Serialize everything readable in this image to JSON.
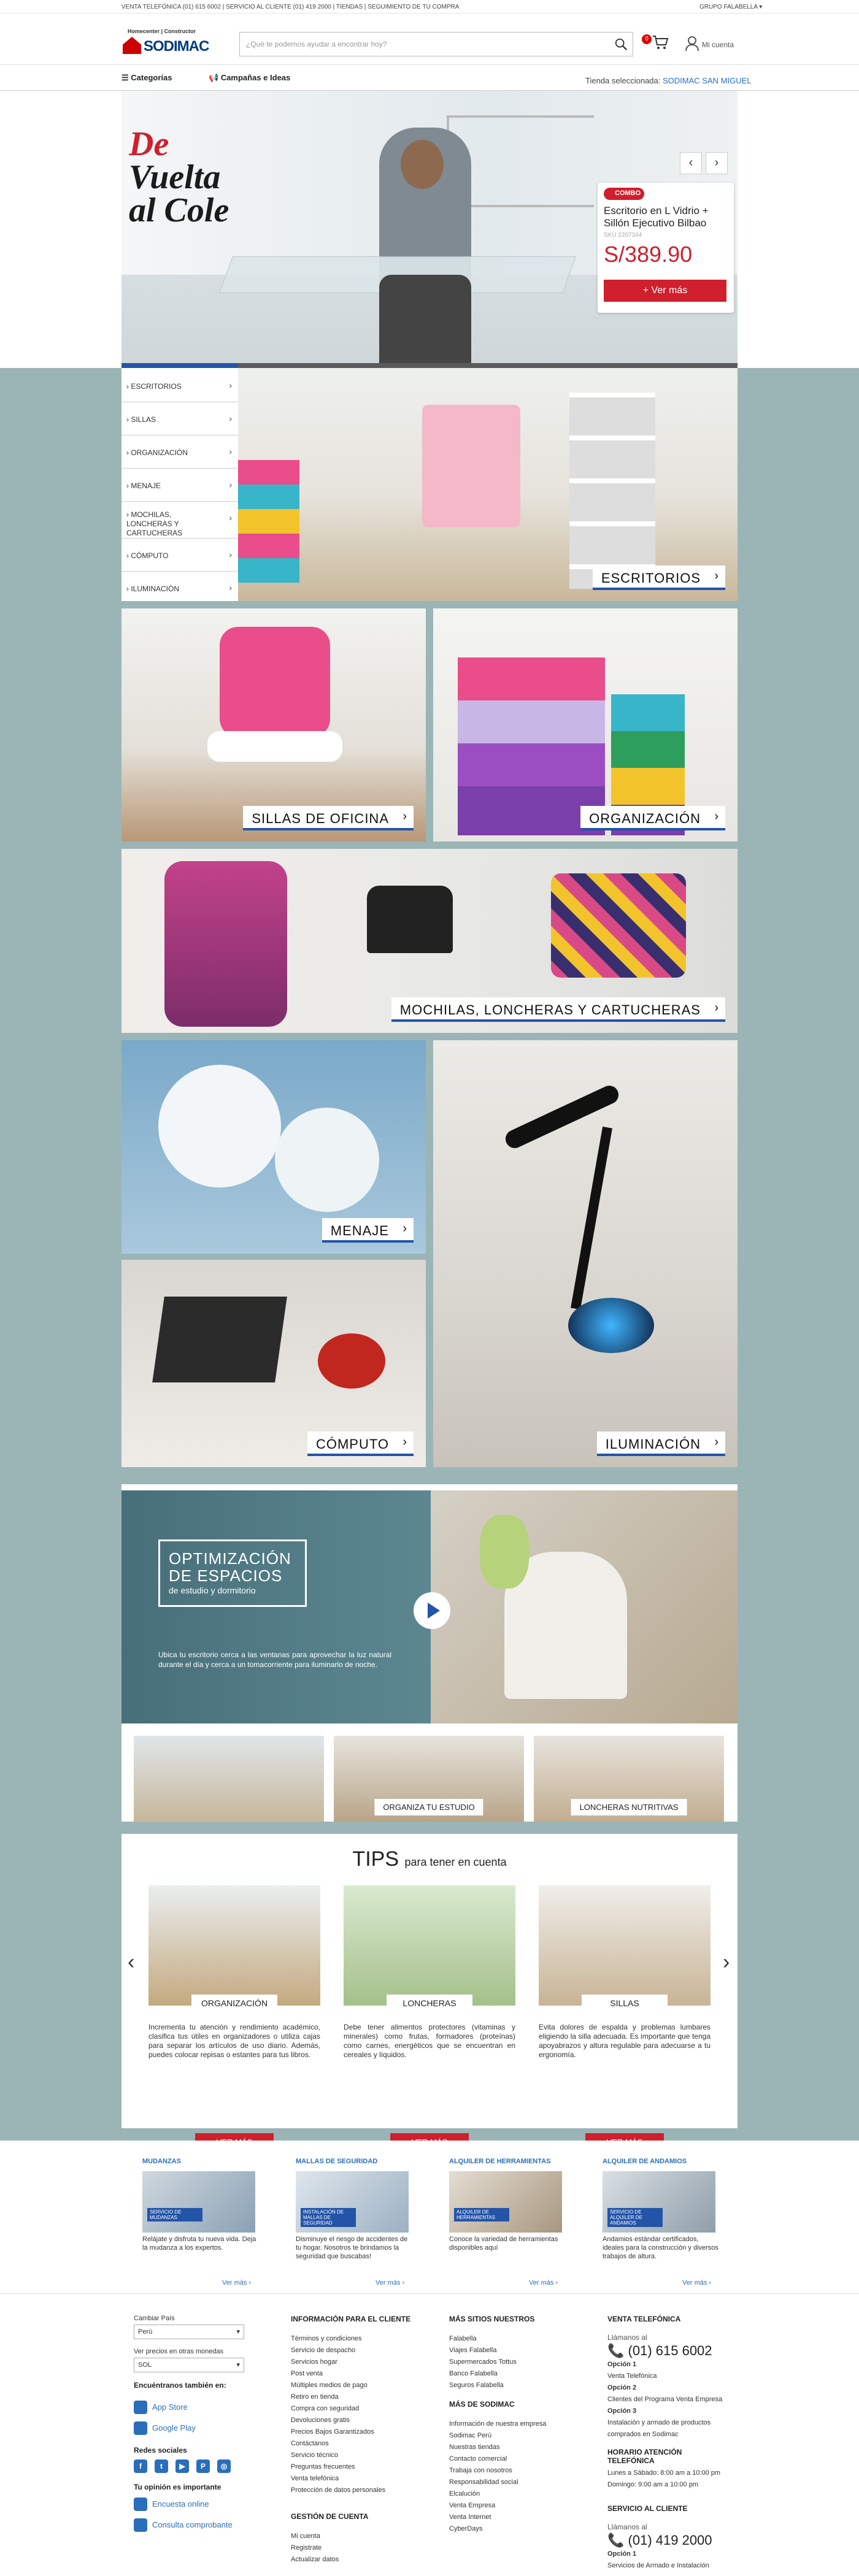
{
  "topbar": {
    "left_text": "VENTA TELEFÓNICA (01) 615 6002 | SERVICIO AL CLIENTE (01) 419 2000 | TIENDAS | SEGUIMIENTO DE TU COMPRA",
    "right_text": "GRUPO FALABELLA"
  },
  "header": {
    "logo_tag": "Homecenter | Constructor",
    "logo_name": "SODIMAC",
    "search_placeholder": "¿Qué te podemos ayudar a encontrar hoy?",
    "cart_count": "0",
    "account_label": "Mi cuenta"
  },
  "nav": {
    "categories": "Categorías",
    "campaigns": "Campañas e Ideas",
    "store_label": "Tienda seleccionada:",
    "store_name": "SODIMAC SAN MIGUEL"
  },
  "hero": {
    "title_line1": "De",
    "title_line2": "Vuelta",
    "title_line3": "al Cole",
    "arrow_prev": "‹",
    "arrow_next": "›",
    "promo": {
      "badge": "COMBO",
      "name": "Escritorio en L Vidrio + Sillón Ejecutivo Bilbao",
      "sku": "SKU 2207344",
      "price": "S/389.90",
      "button": "+ Ver más"
    }
  },
  "category_menu": [
    {
      "label": "ESCRITORIOS"
    },
    {
      "label": "SILLAS"
    },
    {
      "label": "ORGANIZACIÓN"
    },
    {
      "label": "MENAJE"
    },
    {
      "label": "MOCHILAS, LONCHERAS Y CARTUCHERAS"
    },
    {
      "label": "CÓMPUTO"
    },
    {
      "label": "ILUMINACIÓN"
    }
  ],
  "tiles": {
    "escritorios": "ESCRITORIOS",
    "sillas": "SILLAS DE OFICINA",
    "organizacion": "ORGANIZACIÓN",
    "mochilas": "MOCHILAS, LONCHERAS Y CARTUCHERAS",
    "menaje": "MENAJE",
    "computo": "CÓMPUTO",
    "iluminacion": "ILUMINACIÓN"
  },
  "video": {
    "title": "OPTIMIZACIÓN DE ESPACIOS",
    "subtitle": "de estudio y dormitorio",
    "description": "Ubica tu escritorio cerca a las ventanas para aprovechar la luz natural durante el día y cerca a un tomacorriente para iluminarlo de noche.",
    "thumbs": [
      "",
      "ORGANIZA TU ESTUDIO",
      "LONCHERAS NUTRITIVAS"
    ]
  },
  "tips": {
    "title": "TIPS",
    "subtitle": "para tener en cuenta",
    "cards": [
      {
        "caption": "ORGANIZACIÓN",
        "text": "Incrementa tu atención y rendimiento académico, clasifica tus útiles en organizadores o utiliza cajas para separar los artículos de uso diario. Además, puedes colocar repisas o estantes para tus libros.",
        "button": "VER MÁS"
      },
      {
        "caption": "LONCHERAS",
        "text": "Debe tener alimentos protectores (vitaminas y minerales) como frutas, formadores (proteínas) como carnes, energéticos que se encuentran en cereales y líquidos.",
        "button": "VER MÁS"
      },
      {
        "caption": "SILLAS",
        "text": "Evita dolores de espalda y problemas lumbares eligiendo la silla adecuada. Es importante que tenga apoyabrazos y altura regulable para adecuarse a tu ergonomía.",
        "button": "VER MÁS"
      }
    ]
  },
  "services": [
    {
      "title": "MUDANZAS",
      "chip": "SERVICIO DE MUDANZAS",
      "desc": "Relájate y disfruta tu nueva vida. Deja la mudanza a los expertos.",
      "more": "Ver más ›"
    },
    {
      "title": "MALLAS DE SEGURIDAD",
      "chip": "INSTALACIÓN DE MALLAS DE SEGURIDAD",
      "desc": "Disminuye el riesgo de accidentes de tu hogar. Nosotros te brindamos la seguridad que buscabas!",
      "more": "Ver más ›"
    },
    {
      "title": "ALQUILER DE HERRAMIENTAS",
      "chip": "ALQUILER DE HERRAMIENTAS",
      "desc": "Conoce la variedad de herramientas disponibles aquí",
      "more": "Ver más ›"
    },
    {
      "title": "ALQUILER DE ANDAMIOS",
      "chip": "SERVICIO DE ALQUILER DE ANDAMIOS",
      "desc": "Andamios estándar certificados, ideales para la construcción y diversos trabajos de altura.",
      "more": "Ver más ›"
    }
  ],
  "footer": {
    "country_label": "Cambiar País",
    "country_value": "Perú",
    "currency_label": "Ver precios en otras monedas",
    "currency_value": "SOL",
    "stores_title": "Encuéntranos también en:",
    "app_store": "App Store",
    "google_play": "Google Play",
    "social_title": "Redes sociales",
    "social": [
      "f",
      "t",
      "▶",
      "P",
      "◎"
    ],
    "opinion_title": "Tu opinión es importante",
    "survey": "Encuesta online",
    "receipt": "Consulta comprobante",
    "info_title": "INFORMACIÓN PARA EL CLIENTE",
    "info_links": [
      "Términos y condiciones",
      "Servicio de despacho",
      "Servicios hogar",
      "Post venta",
      "Múltiples medios de pago",
      "Retiro en tienda",
      "Compra con seguridad",
      "Devoluciones gratis",
      "Precios Bajos Garantizados",
      "Contáctanos",
      "Servicio técnico",
      "Preguntas frecuentes",
      "Venta telefónica",
      "Protección de datos personales"
    ],
    "account_title": "GESTIÓN DE CUENTA",
    "account_links": [
      "Mi cuenta",
      "Registrate",
      "Actualizar datos"
    ],
    "sites_title": "MÁS SITIOS NUESTROS",
    "sites_links": [
      "Falabella",
      "Viajes Falabella",
      "Supermercados Tottus",
      "Banco Falabella",
      "Seguros Falabella"
    ],
    "more_title": "MÁS DE SODIMAC",
    "more_links": [
      "Información de nuestra empresa",
      "Sodimac Perú",
      "Nuestras tiendas",
      "Contacto comercial",
      "Trabaja con nosotros",
      "Responsabilidad social",
      "Elcalución",
      "Venta Empresa",
      "Venta Internet",
      "CyberDays"
    ],
    "phone_title": "VENTA TELEFÓNICA",
    "phone_call": "Llámanos al",
    "phone_number": "(01) 615 6002",
    "phone_opts": [
      "Opción 1",
      "Venta Telefónica",
      "Opción 2",
      "Clientes del Programa Venta Empresa",
      "Opción 3",
      "Instalación y armado de productos comprados en Sodimac"
    ],
    "hours_title": "HORARIO ATENCIÓN TELEFÓNICA",
    "hours": [
      "Lunes a Sábado: 8:00 am a 10:00 pm",
      "Domingo: 9:00 am a 10:00 pm"
    ],
    "service_title": "SERVICIO AL CLIENTE",
    "service_call": "Llámanos al",
    "service_number": "(01) 419 2000",
    "service_opts": [
      "Opción 1",
      "Servicios de Armado e Instalación"
    ]
  },
  "colors": {
    "brand_red": "#d01f2d",
    "brand_blue": "#2354a8",
    "teal_bg": "#9bb5b6"
  }
}
